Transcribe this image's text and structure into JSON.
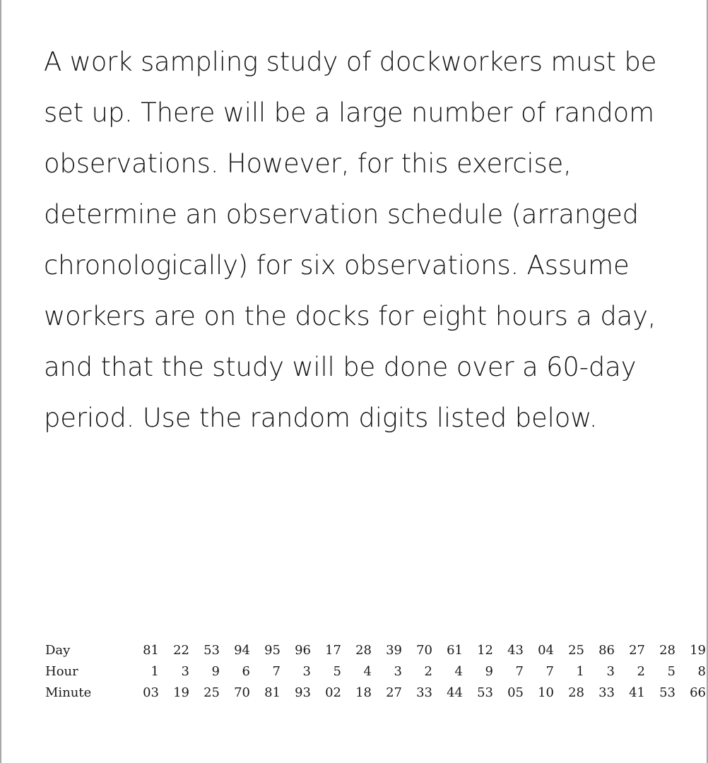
{
  "document": {
    "body_text": "A work sampling study of dockworkers must be set up. There will be a large number of random observations. However, for this exercise, determine an observation schedule (arranged chronologically) for six observations. Assume workers are on the docks for eight hours a day, and that the study will be done over a 60-day period. Use the random digits listed below."
  },
  "chart_data": {
    "type": "table",
    "title": "",
    "row_labels": [
      "Day",
      "Hour",
      "Minute"
    ],
    "columns": 18,
    "series": [
      {
        "name": "Day",
        "values": [
          "81",
          "22",
          "53",
          "94",
          "95",
          "96",
          "17",
          "28",
          "39",
          "70",
          "61",
          "12",
          "43",
          "04",
          "25",
          "86",
          "27",
          "28",
          "19"
        ]
      },
      {
        "name": "Hour",
        "values": [
          "1",
          "3",
          "9",
          "6",
          "7",
          "3",
          "5",
          "4",
          "3",
          "2",
          "4",
          "9",
          "7",
          "7",
          "1",
          "3",
          "2",
          "5",
          "8"
        ]
      },
      {
        "name": "Minute",
        "values": [
          "03",
          "19",
          "25",
          "70",
          "81",
          "93",
          "02",
          "18",
          "27",
          "33",
          "44",
          "53",
          "05",
          "10",
          "28",
          "33",
          "41",
          "53",
          "66"
        ]
      }
    ]
  },
  "style": {
    "background": "#ffffff",
    "text_color": "#151515",
    "border_color": "#a8a8a8"
  }
}
